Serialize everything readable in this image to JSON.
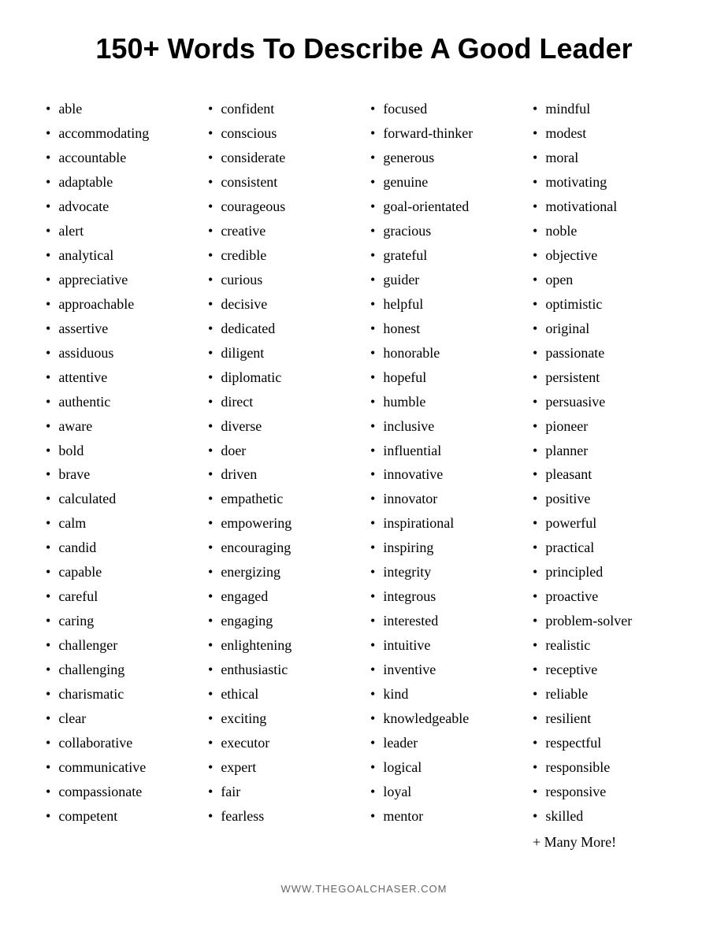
{
  "page": {
    "title": "150+ Words To Describe A Good Leader",
    "footer": "WWW.THEGOALCHASER.COM"
  },
  "columns": {
    "col1": [
      "able",
      "accommodating",
      "accountable",
      "adaptable",
      "advocate",
      "alert",
      "analytical",
      "appreciative",
      "approachable",
      "assertive",
      "assiduous",
      "attentive",
      "authentic",
      "aware",
      "bold",
      "brave",
      "calculated",
      "calm",
      "candid",
      "capable",
      "careful",
      "caring",
      "challenger",
      "challenging",
      "charismatic",
      "clear",
      "collaborative",
      "communicative",
      "compassionate",
      "competent"
    ],
    "col2": [
      "confident",
      "conscious",
      "considerate",
      "consistent",
      "courageous",
      "creative",
      "credible",
      "curious",
      "decisive",
      "dedicated",
      "diligent",
      "diplomatic",
      "direct",
      "diverse",
      "doer",
      "driven",
      "empathetic",
      "empowering",
      "encouraging",
      "energizing",
      "engaged",
      "engaging",
      "enlightening",
      "enthusiastic",
      "ethical",
      "exciting",
      "executor",
      "expert",
      "fair",
      "fearless"
    ],
    "col3": [
      "focused",
      "forward-thinker",
      "generous",
      "genuine",
      "goal-orientated",
      "gracious",
      "grateful",
      "guider",
      "helpful",
      "honest",
      "honorable",
      "hopeful",
      "humble",
      "inclusive",
      "influential",
      "innovative",
      "innovator",
      "inspirational",
      "inspiring",
      "integrity",
      "integrous",
      "interested",
      "intuitive",
      "inventive",
      "kind",
      "knowledgeable",
      "leader",
      "logical",
      "loyal",
      "mentor"
    ],
    "col4": [
      "mindful",
      "modest",
      "moral",
      "motivating",
      "motivational",
      "noble",
      "objective",
      "open",
      "optimistic",
      "original",
      "passionate",
      "persistent",
      "persuasive",
      "pioneer",
      "planner",
      "pleasant",
      "positive",
      "powerful",
      "practical",
      "principled",
      "proactive",
      "problem-solver",
      "realistic",
      "receptive",
      "reliable",
      "resilient",
      "respectful",
      "responsible",
      "responsive",
      "skilled"
    ],
    "more": "+ Many More!"
  }
}
